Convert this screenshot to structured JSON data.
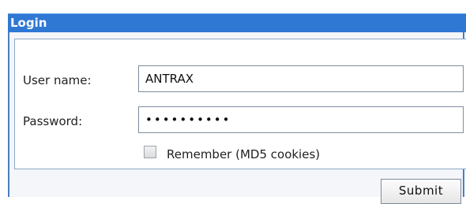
{
  "panel": {
    "title": "Login"
  },
  "form": {
    "username_label": "User name:",
    "username_value": "ANTRAX",
    "password_label": "Password:",
    "password_value": "••••••••••",
    "remember_label": "Remember (MD5 cookies)",
    "remember_checked": false,
    "submit_label": "Submit"
  },
  "colors": {
    "header": "#2f78d4",
    "border": "#4a7fc1"
  }
}
